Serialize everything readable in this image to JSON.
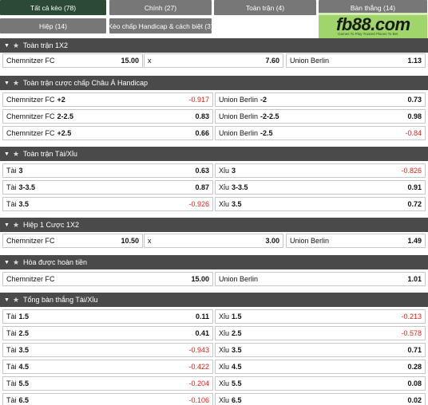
{
  "tabs": [
    {
      "label": "Tất cả kèo (78)",
      "active": true
    },
    {
      "label": "Chính (27)",
      "active": false
    },
    {
      "label": "Toàn trận (4)",
      "active": false
    },
    {
      "label": "Bàn thắng (14)",
      "active": false
    },
    {
      "label": "Hiệp (14)",
      "active": false
    },
    {
      "label": "Kèo chấp Handicap & cách biệt (3)",
      "active": false
    }
  ],
  "logo": {
    "text": "fb88.com",
    "subtitle": "Games To Play  Trusted Places To Bet"
  },
  "sections": [
    {
      "title": "Toàn trận 1X2",
      "rows": [
        [
          {
            "label": "Chemnitzer FC",
            "odd": "15.00"
          },
          {
            "label": "x",
            "odd": "7.60"
          },
          {
            "label": "Union Berlin",
            "odd": "1.13"
          }
        ]
      ]
    },
    {
      "title": "Toàn trận cược chấp Châu Á Handicap",
      "rows": [
        [
          {
            "label": "Chemnitzer FC",
            "hc": "+2",
            "odd": "-0.917"
          },
          {
            "label": "Union Berlin",
            "hc": "-2",
            "odd": "0.73"
          }
        ],
        [
          {
            "label": "Chemnitzer FC",
            "hc": "2-2.5",
            "odd": "0.83"
          },
          {
            "label": "Union Berlin",
            "hc": "-2-2.5",
            "odd": "0.98"
          }
        ],
        [
          {
            "label": "Chemnitzer FC",
            "hc": "+2.5",
            "odd": "0.66"
          },
          {
            "label": "Union Berlin",
            "hc": "-2.5",
            "odd": "-0.84"
          }
        ]
      ]
    },
    {
      "title": "Toàn trận Tài/Xỉu",
      "rows": [
        [
          {
            "label": "Tài",
            "hc": "3",
            "odd": "0.63"
          },
          {
            "label": "Xỉu",
            "hc": "3",
            "odd": "-0.826"
          }
        ],
        [
          {
            "label": "Tài",
            "hc": "3-3.5",
            "odd": "0.87"
          },
          {
            "label": "Xỉu",
            "hc": "3-3.5",
            "odd": "0.91"
          }
        ],
        [
          {
            "label": "Tài",
            "hc": "3.5",
            "odd": "-0.926"
          },
          {
            "label": "Xỉu",
            "hc": "3.5",
            "odd": "0.72"
          }
        ]
      ]
    },
    {
      "title": "Hiệp 1 Cược 1X2",
      "rows": [
        [
          {
            "label": "Chemnitzer FC",
            "odd": "10.50"
          },
          {
            "label": "x",
            "odd": "3.00"
          },
          {
            "label": "Union Berlin",
            "odd": "1.49"
          }
        ]
      ]
    },
    {
      "title": "Hòa được hoàn tiền",
      "rows": [
        [
          {
            "label": "Chemnitzer FC",
            "odd": "15.00"
          },
          {
            "label": "Union Berlin",
            "odd": "1.01"
          }
        ]
      ]
    },
    {
      "title": "Tổng bàn thắng Tài/Xỉu",
      "rows": [
        [
          {
            "label": "Tài",
            "hc": "1.5",
            "odd": "0.11"
          },
          {
            "label": "Xỉu",
            "hc": "1.5",
            "odd": "-0.213"
          }
        ],
        [
          {
            "label": "Tài",
            "hc": "2.5",
            "odd": "0.41"
          },
          {
            "label": "Xỉu",
            "hc": "2.5",
            "odd": "-0.578"
          }
        ],
        [
          {
            "label": "Tài",
            "hc": "3.5",
            "odd": "-0.943"
          },
          {
            "label": "Xỉu",
            "hc": "3.5",
            "odd": "0.71"
          }
        ],
        [
          {
            "label": "Tài",
            "hc": "4.5",
            "odd": "-0.422"
          },
          {
            "label": "Xỉu",
            "hc": "4.5",
            "odd": "0.28"
          }
        ],
        [
          {
            "label": "Tài",
            "hc": "5.5",
            "odd": "-0.204"
          },
          {
            "label": "Xỉu",
            "hc": "5.5",
            "odd": "0.08"
          }
        ],
        [
          {
            "label": "Tài",
            "hc": "6.5",
            "odd": "-0.106"
          },
          {
            "label": "Xỉu",
            "hc": "6.5",
            "odd": "0.02"
          }
        ]
      ]
    }
  ],
  "icons": {
    "collapse": "chevron-down-icon",
    "favorite": "star-icon"
  }
}
